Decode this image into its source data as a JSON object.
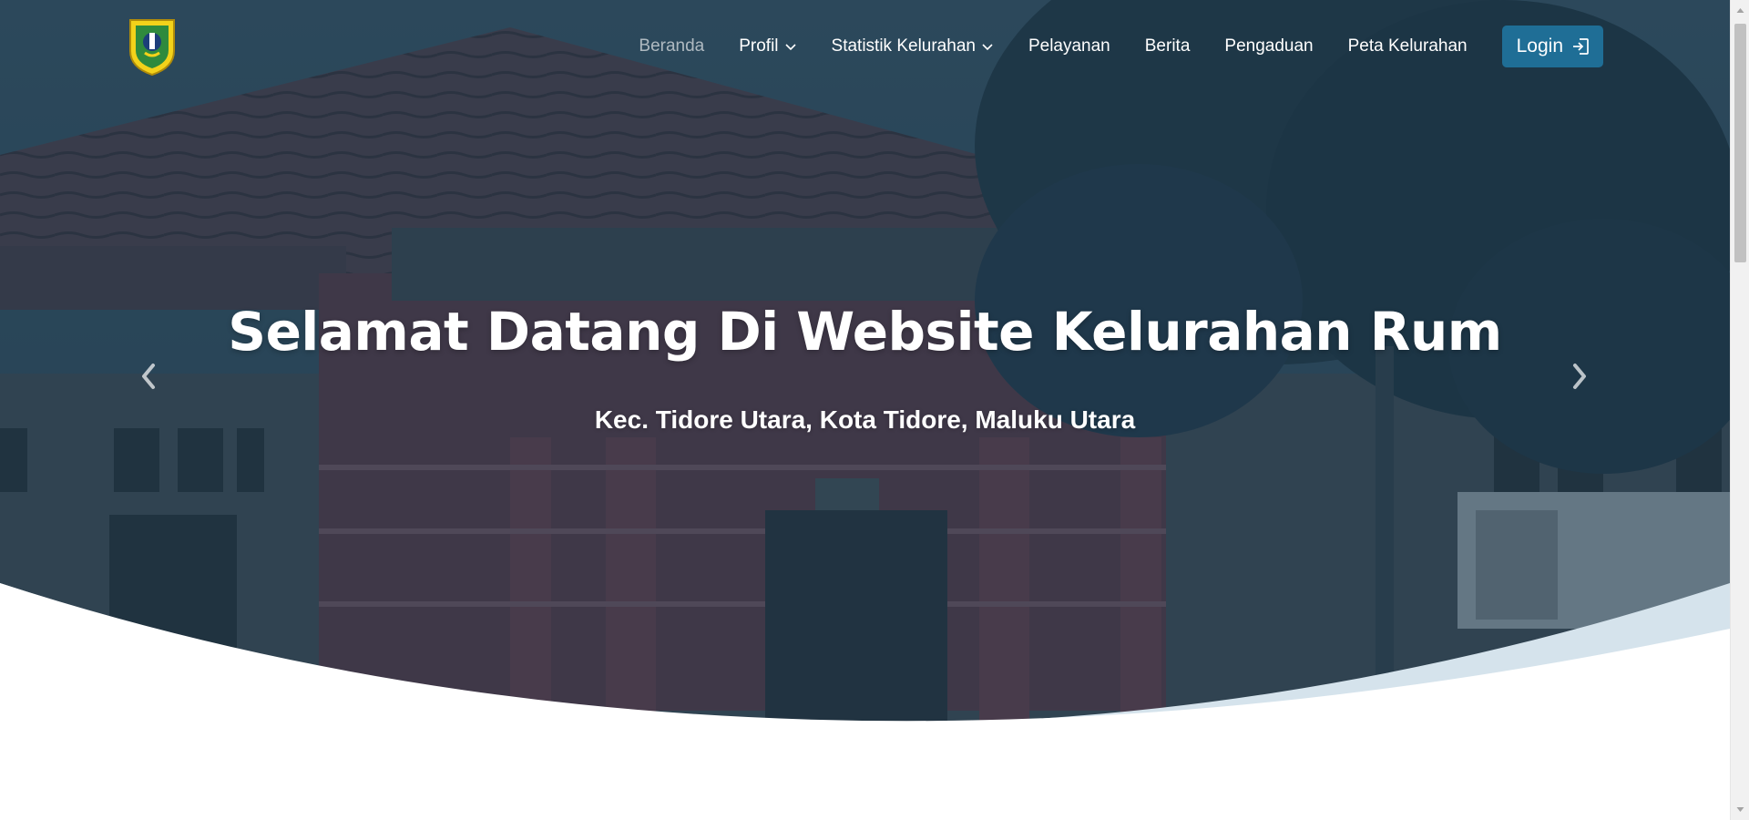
{
  "nav": {
    "items": [
      {
        "label": "Beranda",
        "active": true,
        "has_dropdown": false
      },
      {
        "label": "Profil",
        "active": false,
        "has_dropdown": true
      },
      {
        "label": "Statistik Kelurahan",
        "active": false,
        "has_dropdown": true
      },
      {
        "label": "Pelayanan",
        "active": false,
        "has_dropdown": false
      },
      {
        "label": "Berita",
        "active": false,
        "has_dropdown": false
      },
      {
        "label": "Pengaduan",
        "active": false,
        "has_dropdown": false
      },
      {
        "label": "Peta Kelurahan",
        "active": false,
        "has_dropdown": false
      }
    ],
    "login_label": "Login",
    "login_icon": "login-icon",
    "logo_icon": "coat-of-arms-logo"
  },
  "hero": {
    "title": "Selamat Datang Di Website Kelurahan Rum",
    "subtitle": "Kec. Tidore Utara, Kota Tidore, Maluku Utara",
    "prev_icon": "chevron-left-icon",
    "next_icon": "chevron-right-icon"
  },
  "colors": {
    "overlay": "#1f3a4d",
    "login_button": "#1f6e96",
    "wave_accent": "#d5e3ec",
    "page_background": "#ffffff"
  }
}
